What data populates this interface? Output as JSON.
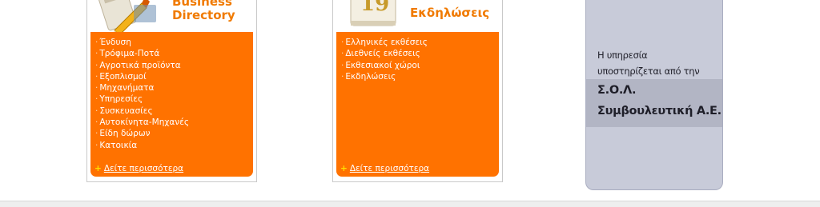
{
  "business_directory": {
    "title_line1": "Business",
    "title_line2": "Directory",
    "items": [
      "Ένδυση",
      "Τρόφιμα-Ποτά",
      "Αγροτικά προϊόντα",
      "Εξοπλισμοί",
      "Μηχανήματα",
      "Υπηρεσίες",
      "Συσκευασίες",
      "Αυτοκίνητα-Μηχανές",
      "Είδη δώρων",
      "Κατοικία"
    ],
    "more_label": "Δείτε περισσότερα"
  },
  "exhibitions": {
    "title": "Εκδηλώσεις",
    "calendar_number": "19",
    "items": [
      "Ελληνικές εκθέσεις",
      "Διεθνείς εκθέσεις",
      "Εκθεσιακοί χώροι",
      "Εκδηλώσεις"
    ],
    "more_label": "Δείτε περισσότερα"
  },
  "support": {
    "line1": "Η υπηρεσία",
    "line2": "υποστηρίζεται από την",
    "company_line1": "Σ.Ο.Λ.",
    "company_line2": "Συμβουλευτική Α.Ε."
  },
  "colors": {
    "orange": "#ff7200",
    "title_orange": "#f07a00",
    "side_panel": "#c8cbd9"
  }
}
